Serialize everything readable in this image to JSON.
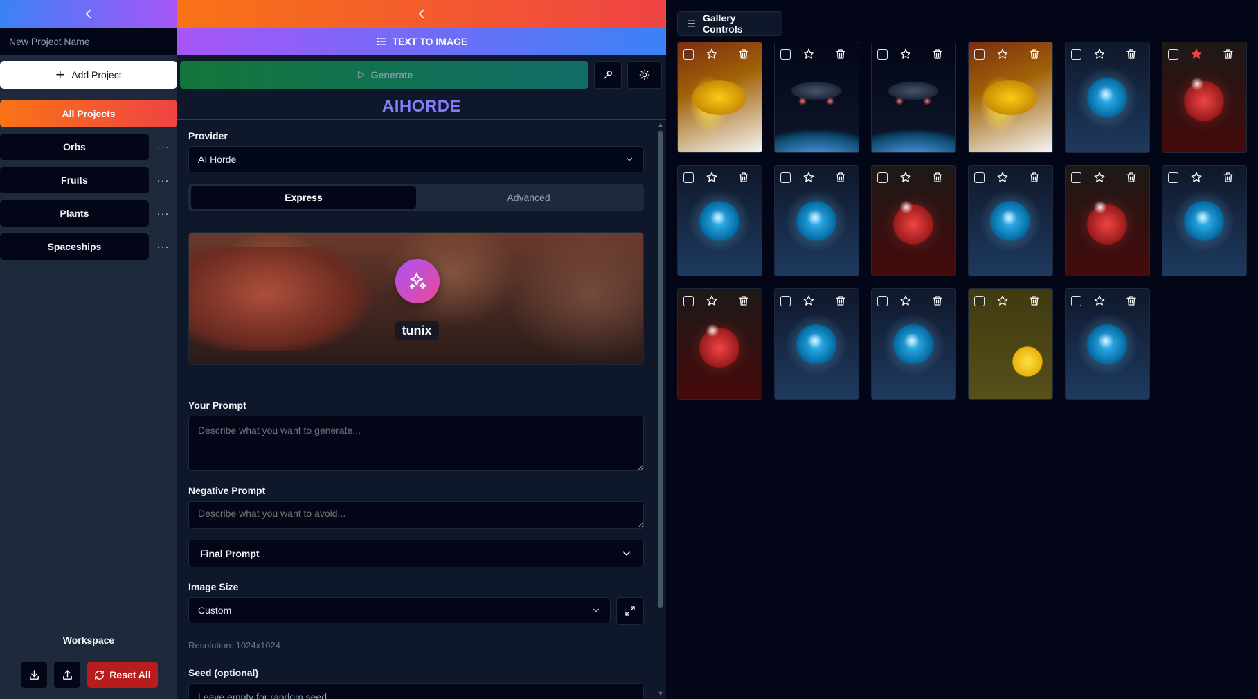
{
  "sidebar": {
    "project_name_placeholder": "New Project Name",
    "add_project_label": "Add Project",
    "all_projects_label": "All Projects",
    "projects": [
      {
        "label": "Orbs"
      },
      {
        "label": "Fruits"
      },
      {
        "label": "Plants"
      },
      {
        "label": "Spaceships"
      }
    ],
    "more_glyph": "···",
    "workspace_label": "Workspace",
    "reset_label": "Reset All"
  },
  "main": {
    "mode_label": "TEXT TO IMAGE",
    "generate_label": "Generate",
    "provider_title": "AIHORDE",
    "provider_label": "Provider",
    "provider_value": "AI Horde",
    "tabs": [
      {
        "label": "Express",
        "active": true
      },
      {
        "label": "Advanced",
        "active": false
      }
    ],
    "model_name": "tunix",
    "prompt_label": "Your Prompt",
    "prompt_placeholder": "Describe what you want to generate...",
    "negative_label": "Negative Prompt",
    "negative_placeholder": "Describe what you want to avoid...",
    "final_prompt_label": "Final Prompt",
    "image_size_label": "Image Size",
    "image_size_value": "Custom",
    "resolution_text": "Resolution: 1024x1024",
    "seed_label": "Seed (optional)",
    "seed_placeholder": "Leave empty for random seed"
  },
  "gallery": {
    "controls_label": "Gallery Controls",
    "images": [
      {
        "subject": "banana",
        "favorited": false
      },
      {
        "subject": "spaceship",
        "favorited": false
      },
      {
        "subject": "spaceship",
        "favorited": false
      },
      {
        "subject": "banana",
        "favorited": false
      },
      {
        "subject": "blue orb",
        "favorited": false
      },
      {
        "subject": "red orb",
        "favorited": true
      },
      {
        "subject": "blue orb",
        "favorited": false
      },
      {
        "subject": "blue orb",
        "favorited": false
      },
      {
        "subject": "red orb",
        "favorited": false
      },
      {
        "subject": "blue orb",
        "favorited": false
      },
      {
        "subject": "red orb",
        "favorited": false
      },
      {
        "subject": "blue orb",
        "favorited": false
      },
      {
        "subject": "red orb",
        "favorited": false
      },
      {
        "subject": "blue orb",
        "favorited": false
      },
      {
        "subject": "blue orb",
        "favorited": false
      },
      {
        "subject": "yellow orb",
        "favorited": false
      },
      {
        "subject": "blue orb",
        "favorited": false
      }
    ]
  },
  "colors": {
    "accent_orange": "#f97316",
    "accent_red": "#ef4444",
    "accent_purple": "#a855f7",
    "accent_blue": "#3b82f6",
    "generate_green": "#15803d",
    "reset_red": "#b91c1c"
  }
}
